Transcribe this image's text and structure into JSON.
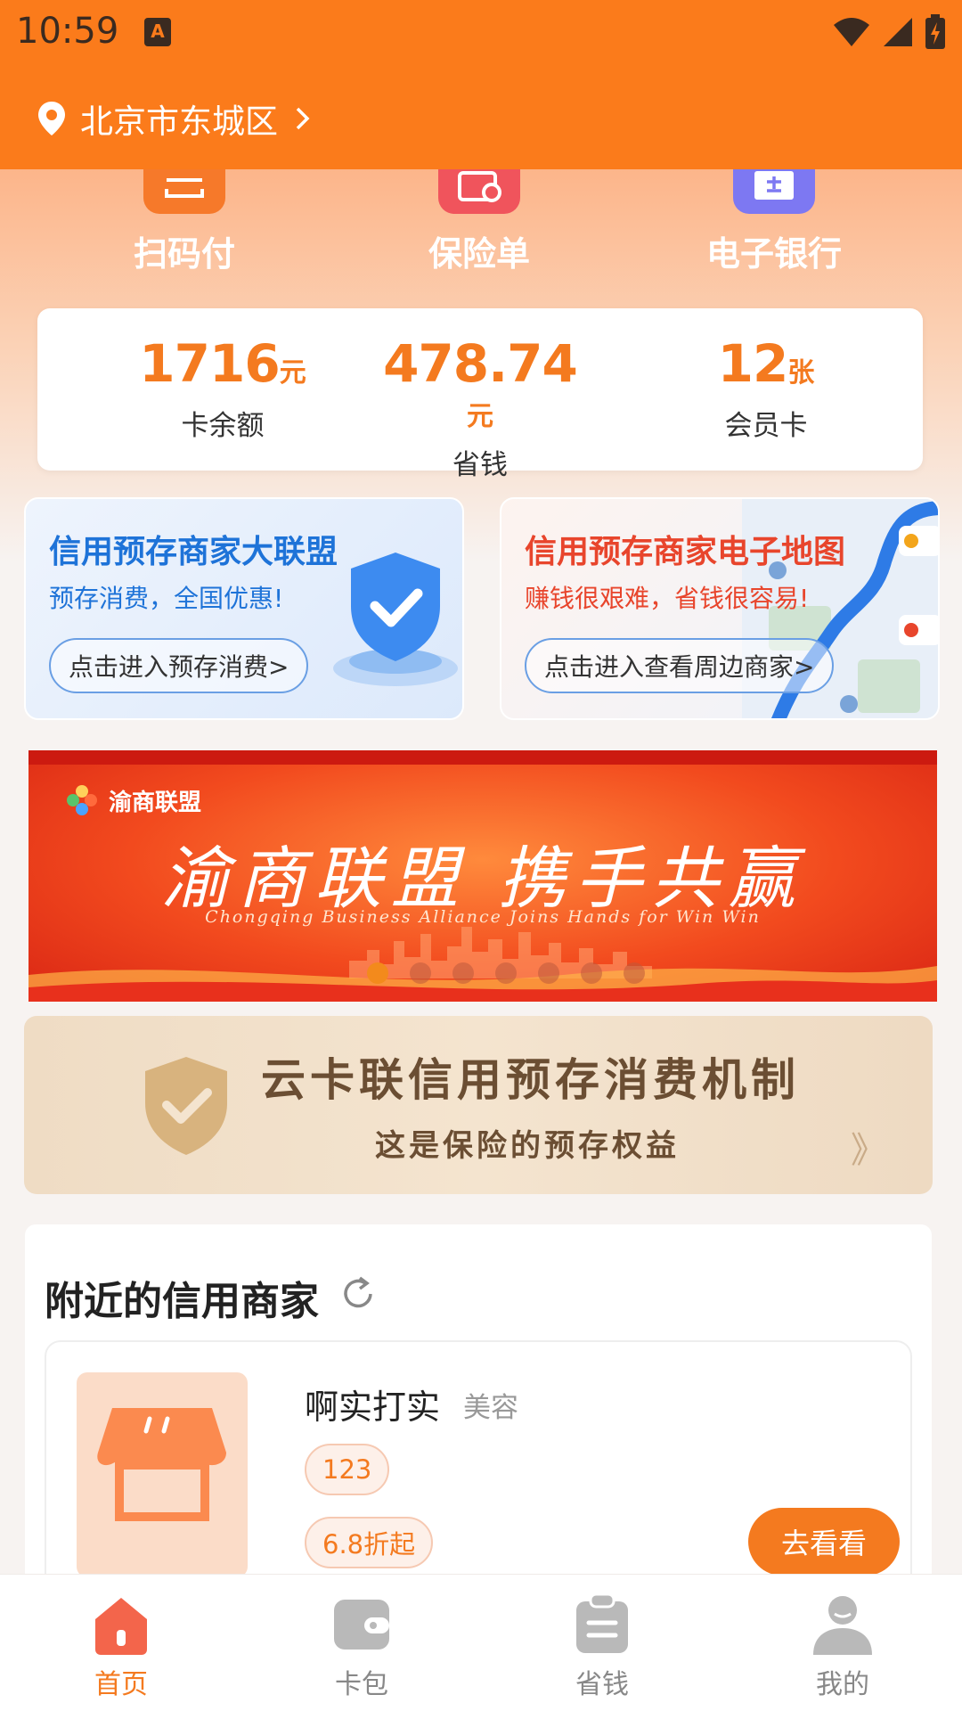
{
  "status_bar": {
    "time": "10:59",
    "notification_glyph": "A"
  },
  "header": {
    "location": "北京市东城区"
  },
  "quick_actions": [
    {
      "label": "扫码付",
      "icon": "scan-icon",
      "color": "#f6792a"
    },
    {
      "label": "保险单",
      "icon": "policy-icon",
      "color": "#f0545c"
    },
    {
      "label": "电子银行",
      "icon": "ebank-icon",
      "color": "#7d78f2"
    }
  ],
  "stats": [
    {
      "value": "1716",
      "unit": "元",
      "label": "卡余额"
    },
    {
      "value": "478.74",
      "unit": "元",
      "label": "省钱"
    },
    {
      "value": "12",
      "unit": "张",
      "label": "会员卡"
    }
  ],
  "promos": [
    {
      "title": "信用预存商家大联盟",
      "subtitle": "预存消费，全国优惠!",
      "button": "点击进入预存消费>",
      "accent": "#1e73d8"
    },
    {
      "title": "信用预存商家电子地图",
      "subtitle": "赚钱很艰难，省钱很容易!",
      "button": "点击进入查看周边商家>",
      "accent": "#e8452c"
    }
  ],
  "banner": {
    "logo_text": "渝商联盟",
    "title": "渝商联盟 携手共赢",
    "subtitle": "Chongqing Business Alliance Joins Hands for Win Win",
    "slide_count": 7,
    "active_slide": 1
  },
  "mechanism": {
    "title": "云卡联信用预存消费机制",
    "subtitle": "这是保险的预存权益",
    "arrow": "》"
  },
  "nearby": {
    "title": "附近的信用商家",
    "merchant": {
      "name": "啊实打实",
      "category": "美容",
      "tags": [
        "123",
        "6.8折起"
      ],
      "button": "去看看"
    }
  },
  "bottom_nav": [
    {
      "label": "首页",
      "icon": "home-icon",
      "active": true
    },
    {
      "label": "卡包",
      "icon": "wallet-icon",
      "active": false
    },
    {
      "label": "省钱",
      "icon": "clipboard-icon",
      "active": false
    },
    {
      "label": "我的",
      "icon": "user-icon",
      "active": false
    }
  ],
  "colors": {
    "primary": "#fb7b1b",
    "accent_orange": "#f47a1f"
  }
}
